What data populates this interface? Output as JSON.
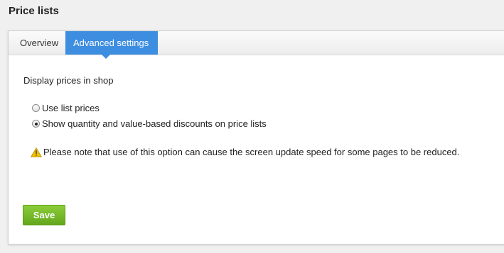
{
  "page": {
    "title": "Price lists"
  },
  "tabs": [
    {
      "label": "Overview",
      "active": false
    },
    {
      "label": "Advanced settings",
      "active": true
    }
  ],
  "display_prices": {
    "label": "Display prices in shop",
    "options": [
      {
        "label": "Use list prices",
        "selected": false
      },
      {
        "label": "Show quantity and value-based discounts on price lists",
        "selected": true
      }
    ]
  },
  "notice": {
    "icon": "warning-icon",
    "text": "Please note that use of this option can cause the screen update speed for some pages to be reduced."
  },
  "actions": {
    "save_label": "Save"
  },
  "colors": {
    "active_tab": "#3d8ee0",
    "save_button": "#76b82a",
    "warning_icon": "#f2c200"
  }
}
